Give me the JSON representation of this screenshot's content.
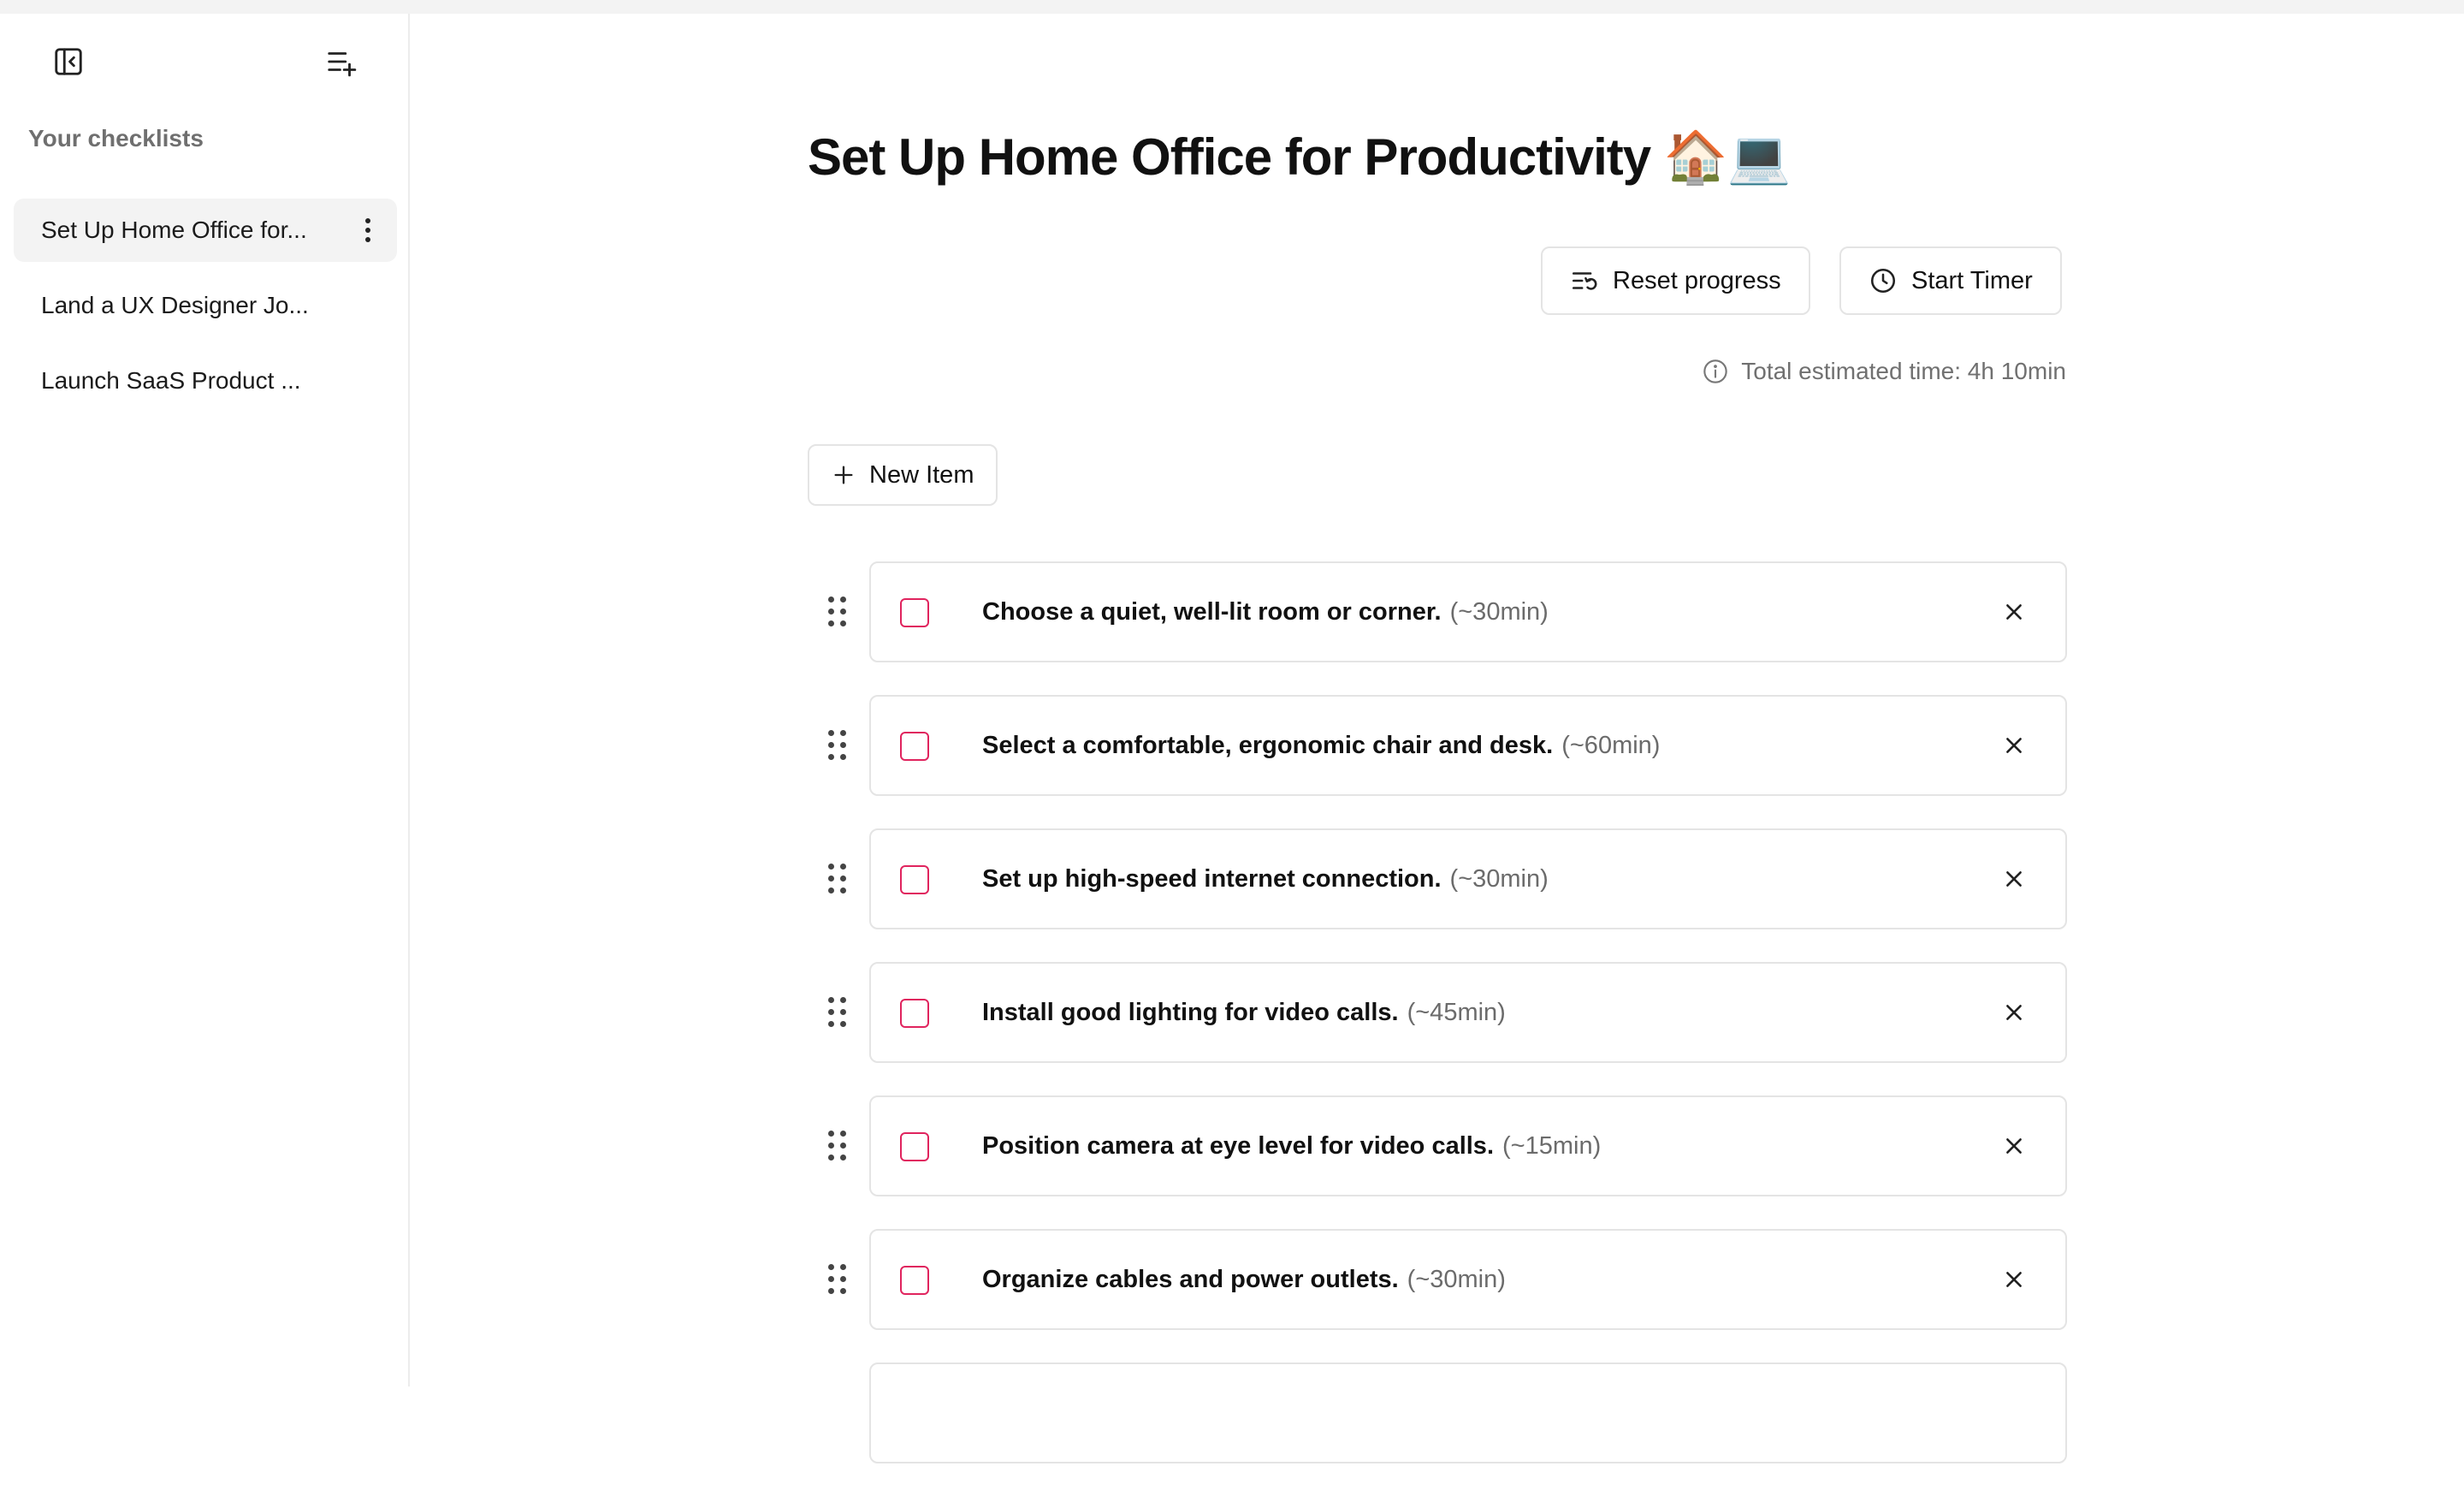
{
  "sidebar": {
    "heading": "Your checklists",
    "items": [
      {
        "label": "Set Up Home Office for..."
      },
      {
        "label": "Land a UX Designer Jo..."
      },
      {
        "label": "Launch SaaS Product ..."
      }
    ]
  },
  "main": {
    "title": "Set Up Home Office for Productivity 🏠💻",
    "reset_label": "Reset progress",
    "timer_label": "Start Timer",
    "total_time": "Total estimated time: 4h 10min",
    "new_item_label": "New Item",
    "items": [
      {
        "text": "Choose a quiet, well-lit room or corner.",
        "estimate": "(~30min)",
        "checked": false
      },
      {
        "text": "Select a comfortable, ergonomic chair and desk.",
        "estimate": "(~60min)",
        "checked": false
      },
      {
        "text": "Set up high-speed internet connection.",
        "estimate": "(~30min)",
        "checked": false
      },
      {
        "text": "Install good lighting for video calls.",
        "estimate": "(~45min)",
        "checked": false
      },
      {
        "text": "Position camera at eye level for video calls.",
        "estimate": "(~15min)",
        "checked": false
      },
      {
        "text": "Organize cables and power outlets.",
        "estimate": "(~30min)",
        "checked": false
      }
    ]
  },
  "colors": {
    "checkbox_border": "#e0245e",
    "active_item_bg": "#f3f3f3",
    "border": "#e4e4e4"
  },
  "icons": {
    "collapse": "sidebar-collapse-icon",
    "new_list": "add-list-icon",
    "reset": "reset-list-icon",
    "timer": "clock-icon",
    "info": "info-icon",
    "plus": "plus-icon",
    "drag": "drag-handle-icon",
    "close": "close-icon",
    "more": "more-vertical-icon"
  }
}
